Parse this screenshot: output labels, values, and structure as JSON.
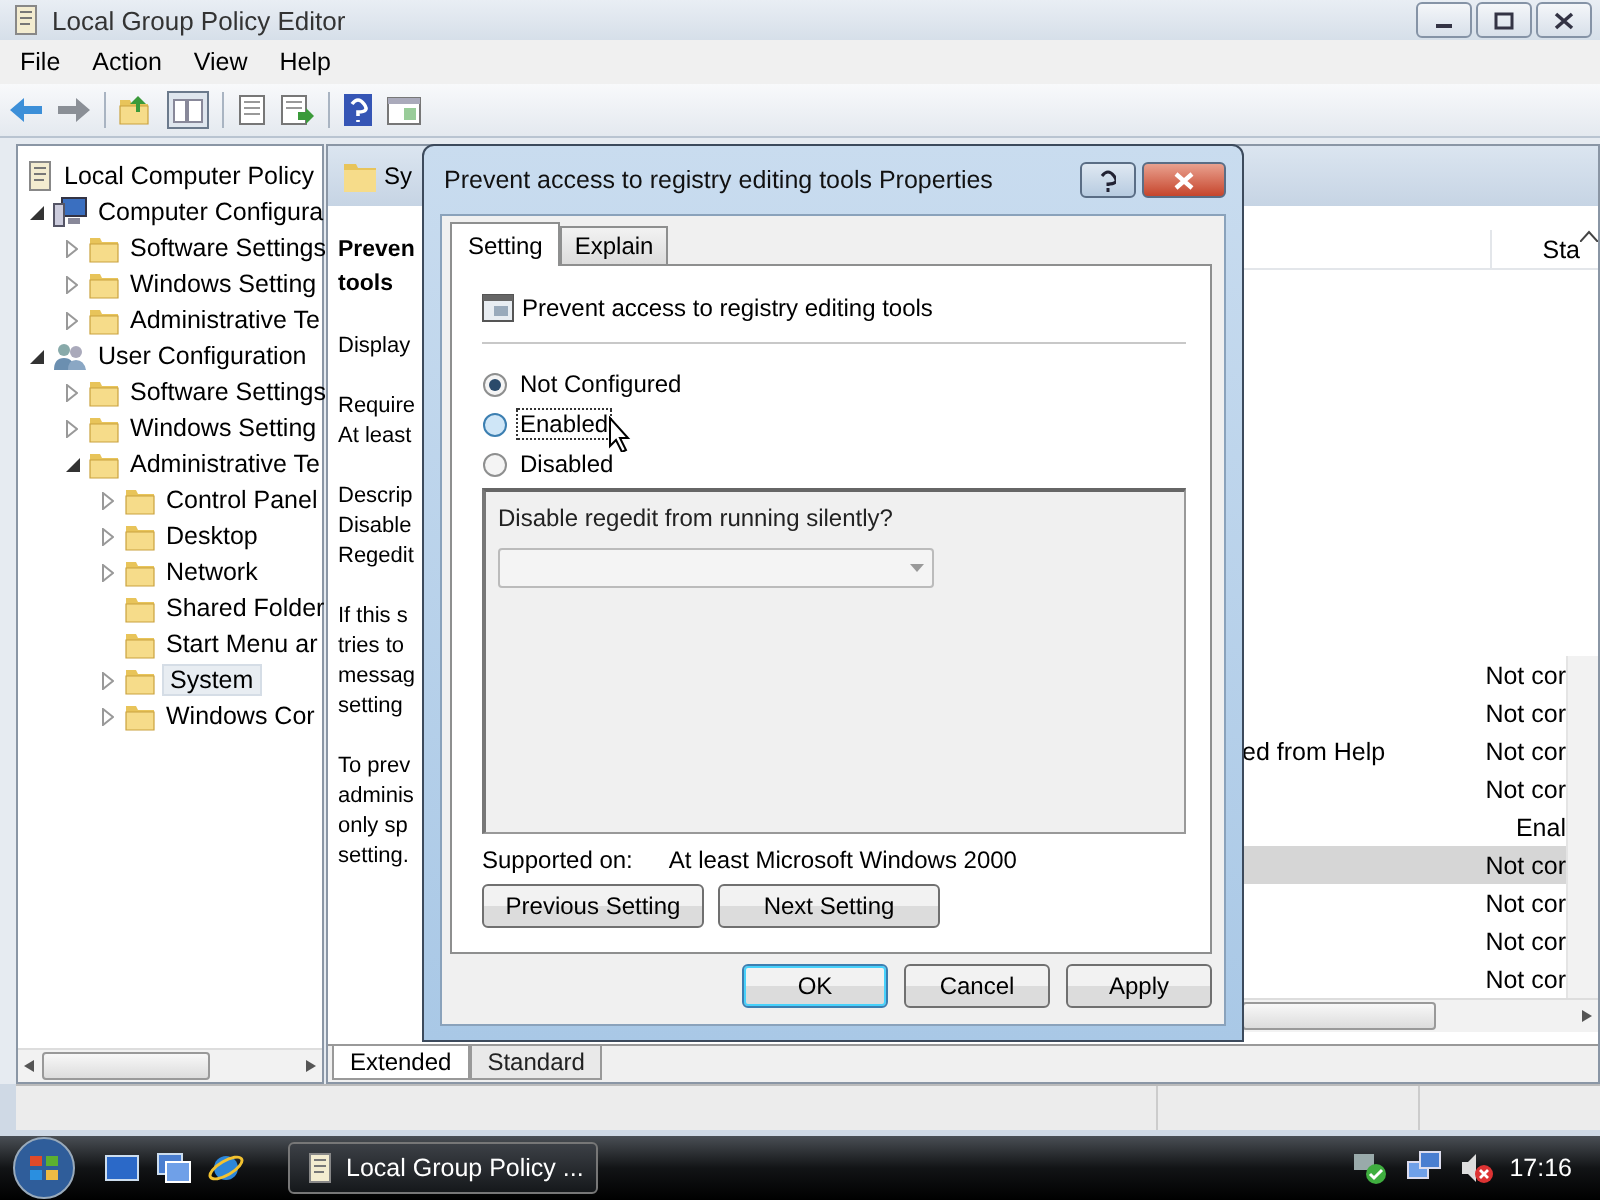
{
  "window": {
    "title": "Local Group Policy Editor"
  },
  "menu": [
    {
      "label": "File"
    },
    {
      "label": "Action"
    },
    {
      "label": "View"
    },
    {
      "label": "Help"
    }
  ],
  "tree": [
    {
      "label": "Local Computer Policy",
      "kind": "policy",
      "selected": false
    },
    {
      "label": "Computer Configura",
      "kind": "computer",
      "expanded": true,
      "selected": false,
      "children": [
        {
          "label": "Software Settings",
          "kind": "folder",
          "expanded": false,
          "selected": false
        },
        {
          "label": "Windows Setting",
          "kind": "folder",
          "expanded": false,
          "selected": false
        },
        {
          "label": "Administrative Te",
          "kind": "folder",
          "expanded": false,
          "selected": false
        }
      ]
    },
    {
      "label": "User Configuration",
      "kind": "user",
      "expanded": true,
      "selected": false,
      "children": [
        {
          "label": "Software Settings",
          "kind": "folder",
          "expanded": false,
          "selected": false
        },
        {
          "label": "Windows Setting",
          "kind": "folder",
          "expanded": false,
          "selected": false
        },
        {
          "label": "Administrative Te",
          "kind": "folder",
          "expanded": true,
          "selected": false,
          "children": [
            {
              "label": "Control Panel",
              "kind": "folder",
              "expanded": false,
              "selected": false
            },
            {
              "label": "Desktop",
              "kind": "folder",
              "expanded": false,
              "selected": false
            },
            {
              "label": "Network",
              "kind": "folder",
              "expanded": false,
              "selected": false
            },
            {
              "label": "Shared Folder",
              "kind": "folder",
              "selected": false
            },
            {
              "label": "Start Menu ar",
              "kind": "folder",
              "selected": false
            },
            {
              "label": "System",
              "kind": "folder",
              "expanded": false,
              "selected": true
            },
            {
              "label": "Windows Cor",
              "kind": "folder",
              "expanded": false,
              "selected": false
            }
          ]
        }
      ]
    }
  ],
  "details": {
    "header": "Sy",
    "title": [
      "Preven",
      "tools"
    ],
    "paragraphs": [
      [
        "Display"
      ],
      [
        "Require",
        "At least"
      ],
      [
        "Descrip",
        "Disable",
        "Regedit"
      ],
      [
        "If this s",
        "tries to",
        "messag",
        "setting"
      ],
      [
        "To prev",
        "adminis",
        "only sp",
        "setting."
      ]
    ]
  },
  "list": {
    "state_header": "Sta",
    "rows": [
      {
        "state": "Not cor",
        "selected": false
      },
      {
        "state": "Not cor",
        "selected": false
      },
      {
        "setting": "ed from Help",
        "state": "Not cor",
        "selected": false
      },
      {
        "state": "Not cor",
        "selected": false
      },
      {
        "state": "Enal",
        "selected": false
      },
      {
        "state": "Not cor",
        "selected": true
      },
      {
        "state": "Not cor",
        "selected": false
      },
      {
        "state": "Not cor",
        "selected": false
      },
      {
        "state": "Not cor",
        "selected": false
      }
    ]
  },
  "view_tabs": [
    {
      "label": "Extended",
      "selected": true
    },
    {
      "label": "Standard",
      "selected": false
    }
  ],
  "dialog": {
    "title": "Prevent access to registry editing tools Properties",
    "tabs": [
      {
        "label": "Setting",
        "selected": true
      },
      {
        "label": "Explain",
        "selected": false
      }
    ],
    "policy": "Prevent access to registry editing tools",
    "options": [
      {
        "label": "Not Configured",
        "selected": true,
        "focused": false
      },
      {
        "label": "Enabled",
        "selected": false,
        "focused": true
      },
      {
        "label": "Disabled",
        "selected": false,
        "focused": false
      }
    ],
    "options_panel": {
      "disabled": true,
      "question": "Disable regedit from running silently?"
    },
    "supported_label": "Supported on:",
    "supported_value": "At least Microsoft Windows 2000",
    "nav_buttons": [
      {
        "label": "Previous Setting"
      },
      {
        "label": "Next Setting"
      }
    ],
    "buttons": [
      {
        "label": "OK",
        "default": true
      },
      {
        "label": "Cancel",
        "default": false
      },
      {
        "label": "Apply",
        "default": false
      }
    ]
  },
  "taskbar": {
    "tasks": [
      {
        "label": "Local Group Policy ...",
        "active": true
      }
    ],
    "clock": "17:16"
  }
}
